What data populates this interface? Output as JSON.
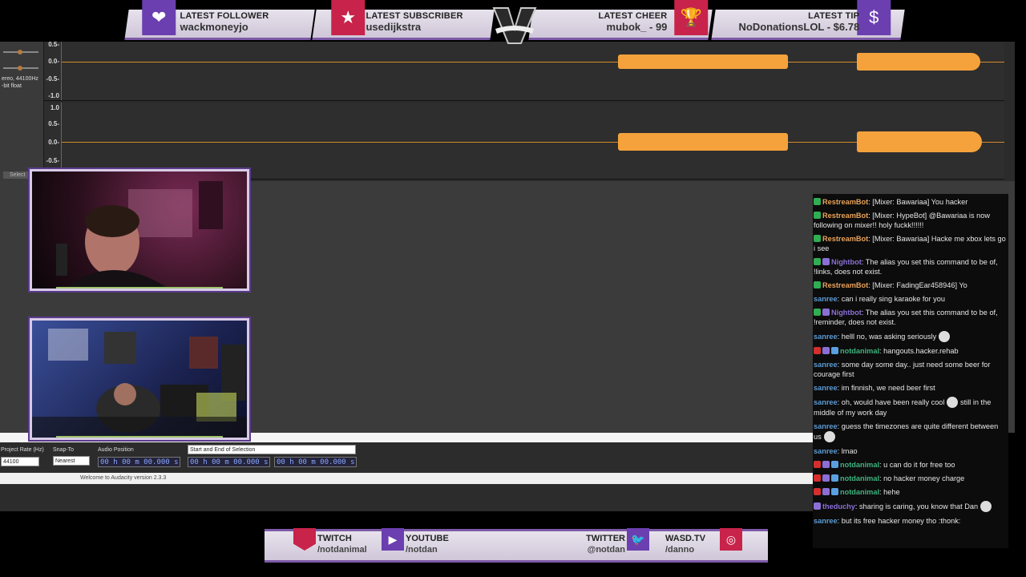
{
  "top_alerts": {
    "follower": {
      "heading": "LATEST FOLLOWER",
      "value": "wackmoneyjo",
      "icon": "heart-icon"
    },
    "subscriber": {
      "heading": "LATEST SUBSCRIBER",
      "value": "usedijkstra",
      "icon": "star-icon"
    },
    "cheer": {
      "heading": "LATEST CHEER",
      "value": "mubok_ - 99",
      "icon": "trophy-icon"
    },
    "tip": {
      "heading": "LATEST TIP",
      "value": "NoDonationsLOL - $6.78",
      "icon": "money-bag-icon"
    },
    "logo": "V"
  },
  "audacity": {
    "track_info": "ereo, 44100Hz\n-bit float",
    "select_label": "Select",
    "track1_scale": [
      "0.5-",
      "0.0-",
      "-0.5-",
      "-1.0"
    ],
    "track2_scale": [
      "1.0",
      "0.5-",
      "0.0-",
      "-0.5-"
    ],
    "project_rate_label": "Project Rate (Hz)",
    "project_rate_value": "44100",
    "snap_to_label": "Snap-To",
    "snap_to_value": "Nearest",
    "audio_position_label": "Audio Position",
    "audio_position_value": "00 h 00 m 00.000 s",
    "selection_mode": "Start and End of Selection",
    "selection_start": "00 h 00 m 00.000 s",
    "selection_end": "00 h 00 m 00.000 s",
    "status": "Welcome to Audacity version 2.3.3"
  },
  "chat": [
    {
      "user": "RestreamBot",
      "color": "#e8a25a",
      "badges": [
        "check"
      ],
      "text": "[Mixer: Bawariaa] You hacker"
    },
    {
      "user": "RestreamBot",
      "color": "#e8a25a",
      "badges": [
        "check"
      ],
      "text": "[Mixer: HypeBot] @Bawariaa is now following on mixer!! holy fuckk!!!!!!"
    },
    {
      "user": "RestreamBot",
      "color": "#e8a25a",
      "badges": [
        "check"
      ],
      "text": "[Mixer: Bawariaa] Hacke me xbox lets go i see"
    },
    {
      "user": "Nightbot",
      "color": "#8b6fd6",
      "badges": [
        "check",
        "mod"
      ],
      "text": "The alias you set this command to be of, !links, does not exist."
    },
    {
      "user": "RestreamBot",
      "color": "#e8a25a",
      "badges": [
        "check"
      ],
      "text": "[Mixer: FadingEar458946] Yo"
    },
    {
      "user": "sanree",
      "color": "#5b9bd5",
      "badges": [],
      "text": "can i really sing karaoke for you"
    },
    {
      "user": "Nightbot",
      "color": "#8b6fd6",
      "badges": [
        "check",
        "mod"
      ],
      "text": "The alias you set this command to be of, !reminder, does not exist."
    },
    {
      "user": "sanree",
      "color": "#5b9bd5",
      "badges": [],
      "text": "helll no, was asking seriously",
      "emote": true
    },
    {
      "user": "notdanimal",
      "color": "#3fb37f",
      "badges": [
        "broadcaster",
        "star",
        "sub"
      ],
      "text": "hangouts.hacker.rehab"
    },
    {
      "user": "sanree",
      "color": "#5b9bd5",
      "badges": [],
      "text": "some day some day.. just need some beer for courage first"
    },
    {
      "user": "sanree",
      "color": "#5b9bd5",
      "badges": [],
      "text": "im finnish, we need beer first"
    },
    {
      "user": "sanree",
      "color": "#5b9bd5",
      "badges": [],
      "text": "oh, would have been really cool",
      "emote": true,
      "text2": "still in the middle of my work day"
    },
    {
      "user": "sanree",
      "color": "#5b9bd5",
      "badges": [],
      "text": "guess the timezones are quite different between us",
      "emote": true
    },
    {
      "user": "sanree",
      "color": "#5b9bd5",
      "badges": [],
      "text": "lmao"
    },
    {
      "user": "notdanimal",
      "color": "#3fb37f",
      "badges": [
        "broadcaster",
        "star",
        "sub"
      ],
      "text": "u can do it for free too"
    },
    {
      "user": "notdanimal",
      "color": "#3fb37f",
      "badges": [
        "broadcaster",
        "star",
        "sub"
      ],
      "text": "no hacker money charge"
    },
    {
      "user": "notdanimal",
      "color": "#3fb37f",
      "badges": [
        "broadcaster",
        "star",
        "sub"
      ],
      "text": "hehe"
    },
    {
      "user": "theduchy",
      "color": "#8b6fd6",
      "badges": [
        "star"
      ],
      "text": "sharing is caring, you know that Dan",
      "emote": true
    },
    {
      "user": "sanree",
      "color": "#5b9bd5",
      "badges": [],
      "text": "but its free hacker money tho :thonk:"
    }
  ],
  "social": {
    "twitch": {
      "name": "TWITCH",
      "handle": "/notdanimal",
      "icon": "twitch-icon"
    },
    "youtube": {
      "name": "YOUTUBE",
      "handle": "/notdan",
      "icon": "youtube-icon"
    },
    "twitter": {
      "name": "TWITTER",
      "handle": "@notdan",
      "icon": "twitter-icon"
    },
    "wasd": {
      "name": "WASD.TV",
      "handle": "/danno",
      "icon": "instagram-icon"
    }
  },
  "colors": {
    "accent": "#6b3fb0",
    "alert_red": "#c8234a",
    "wave": "#f5a23c"
  }
}
